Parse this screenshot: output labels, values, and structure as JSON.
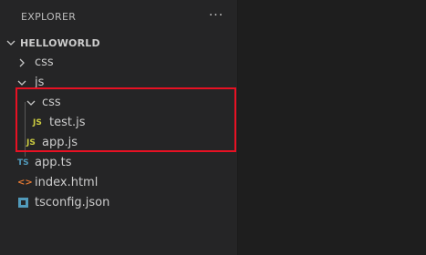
{
  "explorer": {
    "title": "EXPLORER",
    "more_actions": "···",
    "root": "HELLOWORLD",
    "items": [
      {
        "label": "css",
        "kind": "folder-collapsed"
      },
      {
        "label": "js",
        "kind": "folder-expanded"
      },
      {
        "label": "css",
        "kind": "folder-expanded"
      },
      {
        "label": "test.js",
        "kind": "js-file",
        "icon_text": "JS"
      },
      {
        "label": "app.js",
        "kind": "js-file",
        "icon_text": "JS"
      },
      {
        "label": "app.ts",
        "kind": "ts-file",
        "icon_text": "TS"
      },
      {
        "label": "index.html",
        "kind": "html-file",
        "icon_text": "<>"
      },
      {
        "label": "tsconfig.json",
        "kind": "tsconfig-file"
      }
    ]
  },
  "colors": {
    "sidebar_bg": "#252526",
    "editor_bg": "#1e1e1e",
    "highlight_border": "#e81123",
    "js_icon": "#cbcb41",
    "ts_icon": "#519aba",
    "html_icon": "#e37933"
  },
  "icons": [
    "chevron-down-icon",
    "chevron-right-icon",
    "js-file-icon",
    "ts-file-icon",
    "html-file-icon",
    "tsconfig-file-icon",
    "more-actions-icon"
  ]
}
